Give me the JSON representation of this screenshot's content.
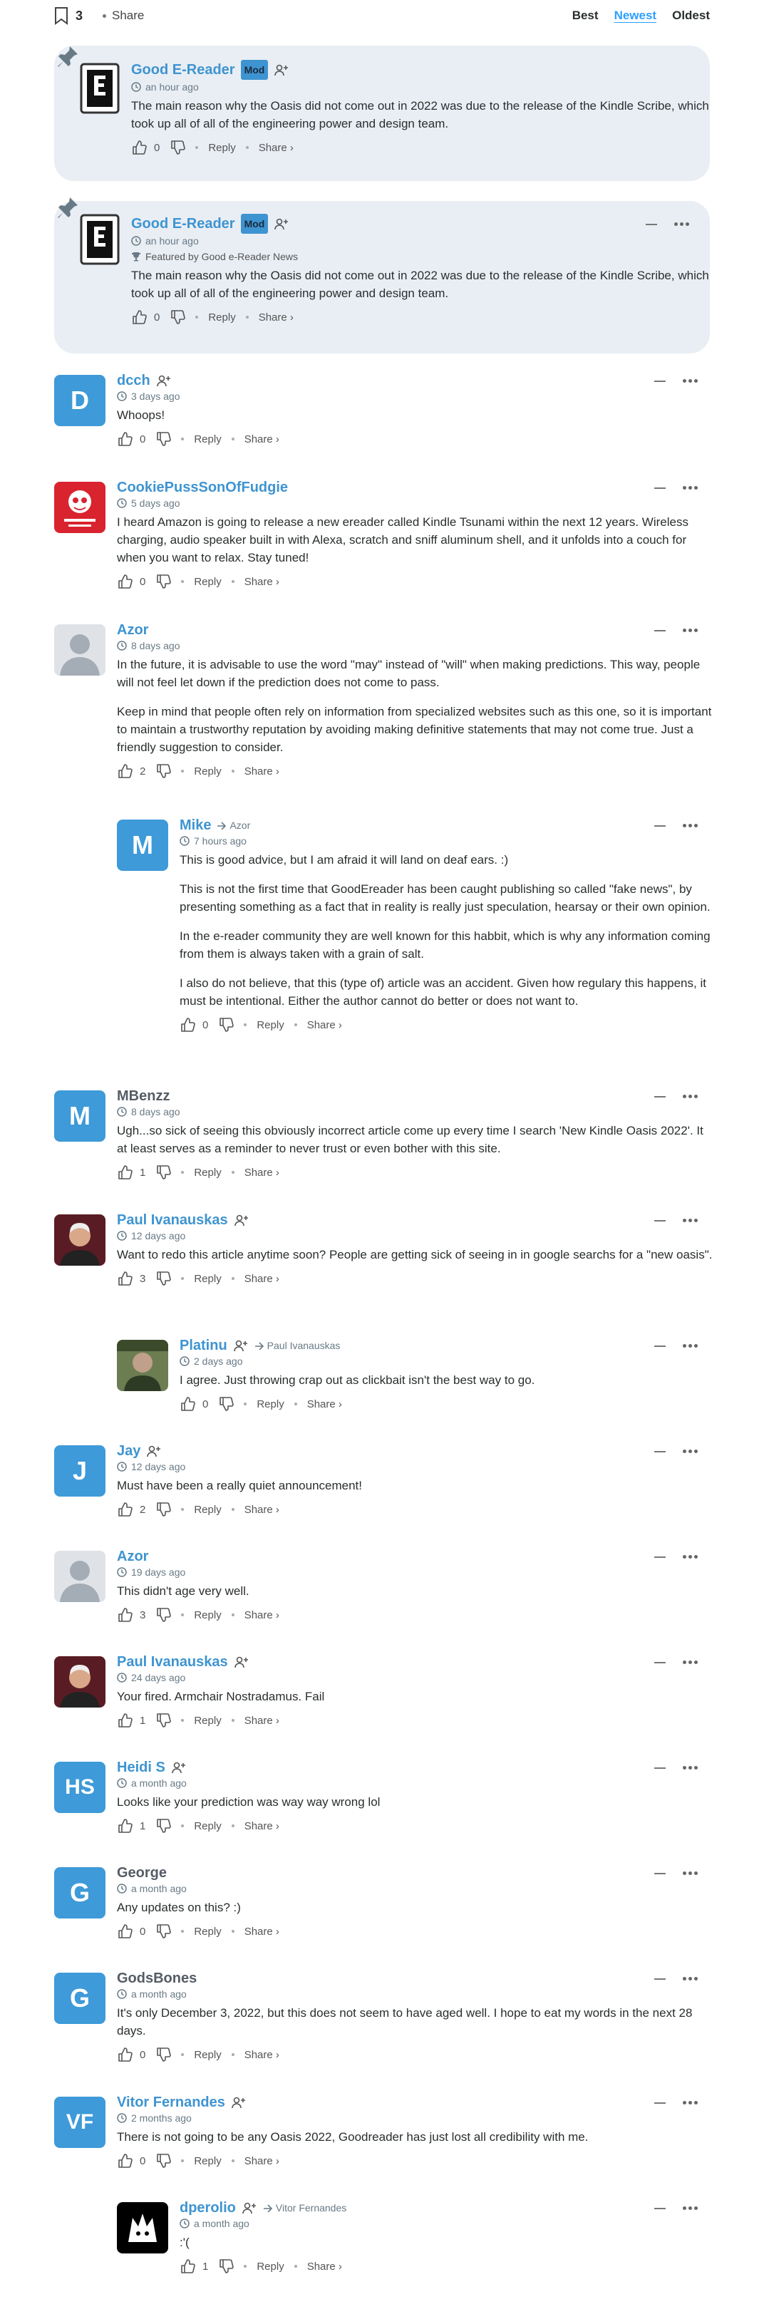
{
  "header": {
    "bookmark_count": "3",
    "share_label": "Share",
    "sort_options": [
      "Best",
      "Newest",
      "Oldest"
    ],
    "active_sort": "Newest"
  },
  "labels": {
    "reply": "Reply",
    "share": "Share ›",
    "mod": "Mod",
    "featured": "Featured by Good e-Reader News"
  },
  "comments": [
    {
      "id": 0,
      "name": "Good E-Reader",
      "time": "an hour ago",
      "likes": "0",
      "text": [
        "The main reason why the Oasis did not come out in 2022 was due to the release of the Kindle Scribe, which took up all of all of the engineering power and design team."
      ]
    },
    {
      "id": 1,
      "name": "Good E-Reader",
      "time": "an hour ago",
      "likes": "0",
      "text": [
        "The main reason why the Oasis did not come out in 2022 was due to the release of the Kindle Scribe, which took up all of all of the engineering power and design team."
      ]
    },
    {
      "id": 2,
      "name": "dcch",
      "initials": "D",
      "time": "3 days ago",
      "likes": "0",
      "text": [
        "Whoops!"
      ]
    },
    {
      "id": 3,
      "name": "CookiePussSonOfFudgie",
      "time": "5 days ago",
      "likes": "0",
      "text": [
        "I heard Amazon is going to release a new ereader called Kindle Tsunami within the next 12 years. Wireless charging, audio speaker built in with Alexa, scratch and sniff aluminum shell, and it unfolds into a couch for when you want to relax. Stay tuned!"
      ]
    },
    {
      "id": 4,
      "name": "Azor",
      "time": "8 days ago",
      "likes": "2",
      "text": [
        "In the future, it is advisable to use the word \"may\" instead of \"will\" when making predictions. This way, people will not feel let down if the prediction does not come to pass.",
        "Keep in mind that people often rely on information from specialized websites such as this one, so it is important to maintain a trustworthy reputation by avoiding making definitive statements that may not come true. Just a friendly suggestion to consider."
      ]
    },
    {
      "id": 5,
      "name": "Mike",
      "reply_to": "Azor",
      "initials": "M",
      "time": "7 hours ago",
      "likes": "0",
      "text": [
        "This is good advice, but I am afraid it will land on deaf ears. :)",
        "This is not the first time that GoodEreader has been caught publishing so called \"fake news\", by presenting something as a fact that in reality is really just speculation, hearsay or their own opinion.",
        "In the e-reader community they are well known for this habbit, which is why any information coming from them is always taken with a grain of salt.",
        "I also do not believe, that this (type of) article was an accident. Given how regulary this happens, it must be intentional. Either the author cannot do better or does not want to."
      ]
    },
    {
      "id": 6,
      "name": "MBenzz",
      "initials": "M",
      "time": "8 days ago",
      "likes": "1",
      "text": [
        "Ugh...so sick of seeing this obviously incorrect article come up every time I search 'New Kindle Oasis 2022'. It at least serves as a reminder to never trust or even bother with this site."
      ]
    },
    {
      "id": 7,
      "name": "Paul Ivanauskas",
      "time": "12 days ago",
      "likes": "3",
      "text": [
        "Want to redo this article anytime soon? People are getting sick of seeing in in google searchs for a \"new oasis\"."
      ]
    },
    {
      "id": 8,
      "name": "Platinu",
      "reply_to": "Paul Ivanauskas",
      "time": "2 days ago",
      "likes": "0",
      "text": [
        "I agree. Just throwing crap out as clickbait isn't the best way to go."
      ]
    },
    {
      "id": 9,
      "name": "Jay",
      "initials": "J",
      "time": "12 days ago",
      "likes": "2",
      "text": [
        "Must have been a really quiet announcement!"
      ]
    },
    {
      "id": 10,
      "name": "Azor",
      "time": "19 days ago",
      "likes": "3",
      "text": [
        "This didn't age very well."
      ]
    },
    {
      "id": 11,
      "name": "Paul Ivanauskas",
      "time": "24 days ago",
      "likes": "1",
      "text": [
        "Your fired. Armchair Nostradamus. Fail"
      ]
    },
    {
      "id": 12,
      "name": "Heidi S",
      "initials": "HS",
      "time": "a month ago",
      "likes": "1",
      "text": [
        "Looks like your prediction was way way wrong lol"
      ]
    },
    {
      "id": 13,
      "name": "George",
      "initials": "G",
      "time": "a month ago",
      "likes": "0",
      "text": [
        "Any updates on this? :)"
      ]
    },
    {
      "id": 14,
      "name": "GodsBones",
      "initials": "G",
      "time": "a month ago",
      "likes": "0",
      "text": [
        "It's only December 3, 2022, but this does not seem to have aged well. I hope to eat my words in the next 28 days."
      ]
    },
    {
      "id": 15,
      "name": "Vitor Fernandes",
      "initials": "VF",
      "time": "2 months ago",
      "likes": "0",
      "text": [
        "There is not going to be any Oasis 2022, Goodreader has just lost all credibility with me."
      ]
    },
    {
      "id": 16,
      "name": "dperolio",
      "reply_to": "Vitor Fernandes",
      "time": "a month ago",
      "likes": "1",
      "text": [
        ":'("
      ]
    }
  ]
}
